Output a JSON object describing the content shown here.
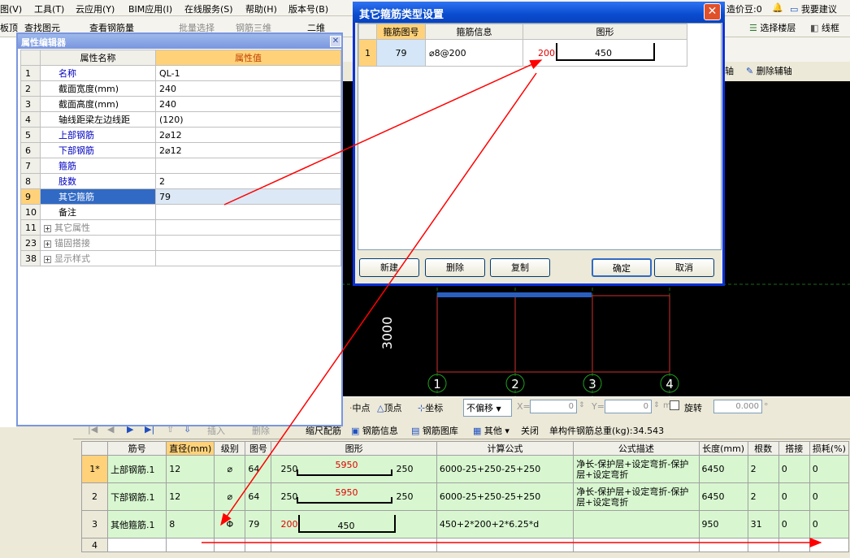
{
  "menu": [
    "图(V)",
    "工具(T)",
    "云应用(Y)",
    "BIM应用(I)",
    "在线服务(S)",
    "帮助(H)",
    "版本号(B)"
  ],
  "menu_right": {
    "coins": "造价豆:0",
    "suggest": "我要建议"
  },
  "toolbar1": {
    "item0": "板顶",
    "item1": "查找图元",
    "item2": "查看钢筋量",
    "item3": "批量选择",
    "item4": "钢筋三维",
    "view_mode": "二维",
    "select_floor": "选择楼层",
    "wireframe": "线框"
  },
  "toolbar2": {
    "axis": "轴",
    "delete_aux_axis": "删除辅轴"
  },
  "prop_editor": {
    "title": "属性编辑器",
    "col_name": "属性名称",
    "col_value": "属性值",
    "rows": [
      {
        "no": "1",
        "name": "名称",
        "value": "QL-1"
      },
      {
        "no": "2",
        "name": "截面宽度(mm)",
        "value": "240"
      },
      {
        "no": "3",
        "name": "截面高度(mm)",
        "value": "240"
      },
      {
        "no": "4",
        "name": "轴线距梁左边线距",
        "value": "(120)"
      },
      {
        "no": "5",
        "name": "上部钢筋",
        "value": "2⌀12"
      },
      {
        "no": "6",
        "name": "下部钢筋",
        "value": "2⌀12"
      },
      {
        "no": "7",
        "name": "箍筋",
        "value": ""
      },
      {
        "no": "8",
        "name": "肢数",
        "value": "2"
      },
      {
        "no": "9",
        "name": "其它箍筋",
        "value": "79"
      },
      {
        "no": "10",
        "name": "备注",
        "value": ""
      },
      {
        "no": "11",
        "name": "其它属性",
        "value": ""
      },
      {
        "no": "23",
        "name": "锚固搭接",
        "value": ""
      },
      {
        "no": "38",
        "name": "显示样式",
        "value": ""
      }
    ]
  },
  "dialog": {
    "title": "其它箍筋类型设置",
    "headers": [
      "箍筋图号",
      "箍筋信息",
      "图形"
    ],
    "row": {
      "no": "1",
      "code": "79",
      "info": "⌀8@200",
      "shape_left": "200",
      "shape_mid": "450"
    },
    "buttons": {
      "new": "新建",
      "delete": "删除",
      "copy": "复制",
      "ok": "确定",
      "cancel": "取消"
    }
  },
  "canvas": {
    "dim_label": "3000",
    "axis_labels": [
      "1",
      "2",
      "3",
      "4"
    ]
  },
  "snapbar": {
    "midpoint": "中点",
    "vertex": "顶点",
    "coord": "坐标",
    "offset": "不偏移",
    "x_label": "X=",
    "x_val": "0",
    "y_label": "Y=",
    "y_val": "0",
    "unit": "mm",
    "rotate": "旋转",
    "rotate_val": "0.000"
  },
  "bottom_toolbar": {
    "insert": "插入",
    "delete": "删除",
    "scale": "缩尺配筋",
    "info": "钢筋信息",
    "lib": "钢筋图库",
    "other": "其他",
    "close": "关闭",
    "total": "单构件钢筋总重(kg):34.543"
  },
  "rebar_table": {
    "headers": [
      "筋号",
      "直径(mm)",
      "级别",
      "图号",
      "图形",
      "计算公式",
      "公式描述",
      "长度(mm)",
      "根数",
      "搭接",
      "损耗(%)"
    ],
    "rows": [
      {
        "no": "1*",
        "name": "上部钢筋.1",
        "dia": "12",
        "grade": "⌀",
        "code": "64",
        "s_left": "250",
        "s_mid": "5950",
        "s_right": "250",
        "formula": "6000-25+250-25+250",
        "desc": "净长-保护层+设定弯折-保护层+设定弯折",
        "len": "6450",
        "count": "2",
        "lap": "0",
        "loss": "0"
      },
      {
        "no": "2",
        "name": "下部钢筋.1",
        "dia": "12",
        "grade": "⌀",
        "code": "64",
        "s_left": "250",
        "s_mid": "5950",
        "s_right": "250",
        "formula": "6000-25+250-25+250",
        "desc": "净长-保护层+设定弯折-保护层+设定弯折",
        "len": "6450",
        "count": "2",
        "lap": "0",
        "loss": "0"
      },
      {
        "no": "3",
        "name": "其他箍筋.1",
        "dia": "8",
        "grade": "Φ",
        "code": "79",
        "s_left": "200",
        "s_mid": "450",
        "s_right": "",
        "formula": "450+2*200+2*6.25*d",
        "desc": "",
        "len": "950",
        "count": "31",
        "lap": "0",
        "loss": "0"
      },
      {
        "no": "4",
        "name": "",
        "dia": "",
        "grade": "",
        "code": "",
        "s_left": "",
        "s_mid": "",
        "s_right": "",
        "formula": "",
        "desc": "",
        "len": "",
        "count": "",
        "lap": "",
        "loss": ""
      }
    ]
  },
  "colors": {
    "accent": "#ff0000",
    "canvas_bg": "#000000",
    "header_highlight": "#ffd27a",
    "row_green": "#d8f7d0"
  }
}
